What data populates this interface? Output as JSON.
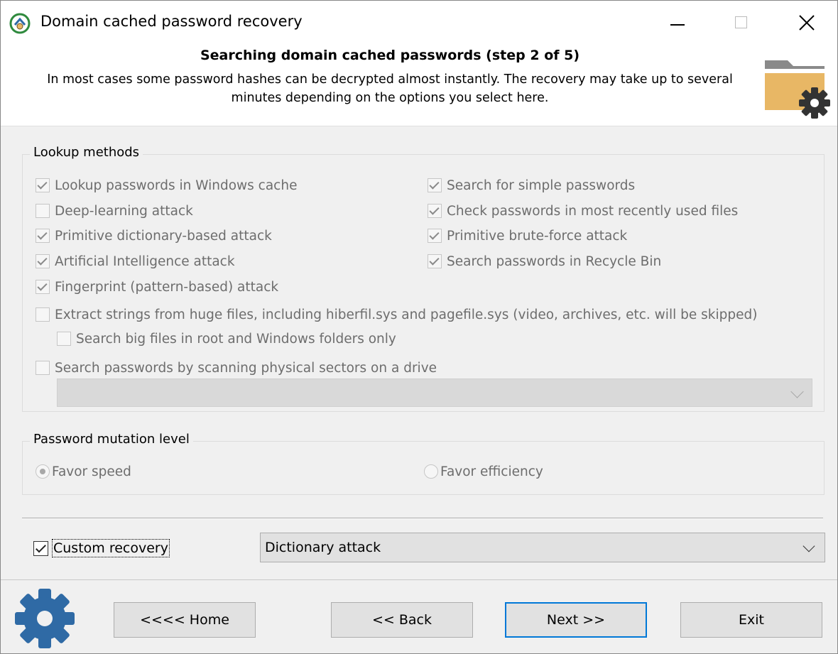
{
  "window": {
    "title": "Domain cached password recovery",
    "controls": [
      "minimize",
      "maximize",
      "close"
    ]
  },
  "header": {
    "step_title": "Searching domain cached passwords (step 2 of 5)",
    "description": "In most cases some password hashes can be decrypted almost instantly. The recovery may take up to several minutes depending on the options you select here.",
    "icon": "folder-gear-icon"
  },
  "lookup": {
    "legend": "Lookup methods",
    "items": [
      {
        "label": "Lookup passwords in Windows cache",
        "checked": true,
        "enabled": false
      },
      {
        "label": "Search for simple passwords",
        "checked": true,
        "enabled": false
      },
      {
        "label": "Deep-learning attack",
        "checked": false,
        "enabled": false
      },
      {
        "label": "Check passwords in most recently used files",
        "checked": true,
        "enabled": false
      },
      {
        "label": "Primitive dictionary-based attack",
        "checked": true,
        "enabled": false
      },
      {
        "label": "Primitive brute-force attack",
        "checked": true,
        "enabled": false
      },
      {
        "label": "Artificial Intelligence attack",
        "checked": true,
        "enabled": false
      },
      {
        "label": "Search passwords in Recycle Bin",
        "checked": true,
        "enabled": false
      },
      {
        "label": "Fingerprint (pattern-based) attack",
        "checked": true,
        "enabled": false
      },
      {
        "label": "Extract strings from huge files, including hiberfil.sys and pagefile.sys (video, archives, etc. will be skipped)",
        "checked": false,
        "enabled": false
      },
      {
        "label": "Search big files in root and Windows folders only",
        "checked": false,
        "enabled": false
      },
      {
        "label": "Search passwords by scanning physical sectors on a drive",
        "checked": false,
        "enabled": false
      }
    ],
    "drive_select_value": ""
  },
  "mutation": {
    "legend": "Password mutation level",
    "options": [
      {
        "label": "Favor speed",
        "selected": true
      },
      {
        "label": "Favor efficiency",
        "selected": false
      }
    ]
  },
  "custom": {
    "label": "Custom recovery",
    "checked": true,
    "selected_method": "Dictionary attack"
  },
  "footer": {
    "home_label": "<<<< Home",
    "back_label": "<< Back",
    "next_label": "Next >>",
    "exit_label": "Exit"
  },
  "colors": {
    "accent": "#0078d7",
    "gear_blue": "#2f6aa5",
    "folder_tan": "#e8b765",
    "disabled_text": "#6d6d6d"
  }
}
